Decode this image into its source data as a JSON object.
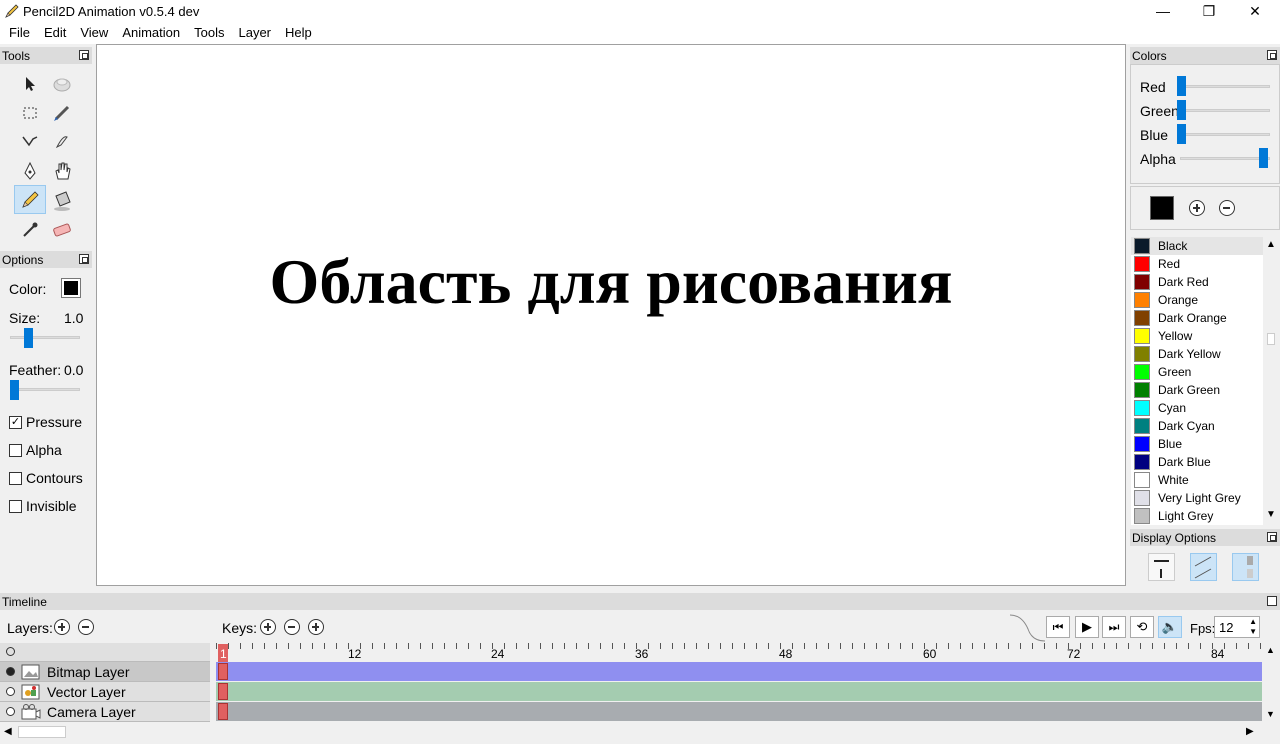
{
  "window": {
    "title": "Pencil2D Animation v0.5.4 dev",
    "minimize": "—",
    "maximize": "❐",
    "close": "✕"
  },
  "menu": [
    "File",
    "Edit",
    "View",
    "Animation",
    "Tools",
    "Layer",
    "Help"
  ],
  "tools_panel": {
    "title": "Tools"
  },
  "options_panel": {
    "title": "Options",
    "color_label": "Color:",
    "size_label": "Size:",
    "size_value": "1.0",
    "feather_label": "Feather:",
    "feather_value": "0.0",
    "checkboxes": [
      {
        "label": "Pressure",
        "checked": true
      },
      {
        "label": "Alpha",
        "checked": false
      },
      {
        "label": "Contours",
        "checked": false
      },
      {
        "label": "Invisible",
        "checked": false
      }
    ]
  },
  "canvas": {
    "text": "Область для рисования"
  },
  "colors_panel": {
    "title": "Colors",
    "sliders": [
      {
        "label": "Red",
        "level": 0
      },
      {
        "label": "Green",
        "level": 0
      },
      {
        "label": "Blue",
        "level": 0
      },
      {
        "label": "Alpha",
        "level": 1
      }
    ],
    "current_color": "#000000"
  },
  "palette": [
    {
      "name": "Black",
      "color": "#0a1a2a",
      "selected": true
    },
    {
      "name": "Red",
      "color": "#ff0000"
    },
    {
      "name": "Dark Red",
      "color": "#800000"
    },
    {
      "name": "Orange",
      "color": "#ff8000"
    },
    {
      "name": "Dark Orange",
      "color": "#804000"
    },
    {
      "name": "Yellow",
      "color": "#ffff00"
    },
    {
      "name": "Dark Yellow",
      "color": "#808000"
    },
    {
      "name": "Green",
      "color": "#00ff00"
    },
    {
      "name": "Dark Green",
      "color": "#008000"
    },
    {
      "name": "Cyan",
      "color": "#00ffff"
    },
    {
      "name": "Dark Cyan",
      "color": "#008080"
    },
    {
      "name": "Blue",
      "color": "#0000ff"
    },
    {
      "name": "Dark Blue",
      "color": "#000080"
    },
    {
      "name": "White",
      "color": "#ffffff"
    },
    {
      "name": "Very Light Grey",
      "color": "#e0e0e8"
    },
    {
      "name": "Light Grey",
      "color": "#c0c0c0"
    }
  ],
  "display_options": {
    "title": "Display Options"
  },
  "timeline": {
    "title": "Timeline",
    "layers_label": "Layers:",
    "keys_label": "Keys:",
    "fps_label": "Fps:",
    "fps_value": "12",
    "ruler_labels": [
      "1",
      "12",
      "24",
      "36",
      "48",
      "60",
      "72",
      "84"
    ],
    "layers": [
      {
        "name": "Bitmap Layer",
        "color": "#8f8ff0"
      },
      {
        "name": "Vector Layer",
        "color": "#a4ccb0"
      },
      {
        "name": "Camera Layer",
        "color": "#a8acb0"
      }
    ]
  }
}
